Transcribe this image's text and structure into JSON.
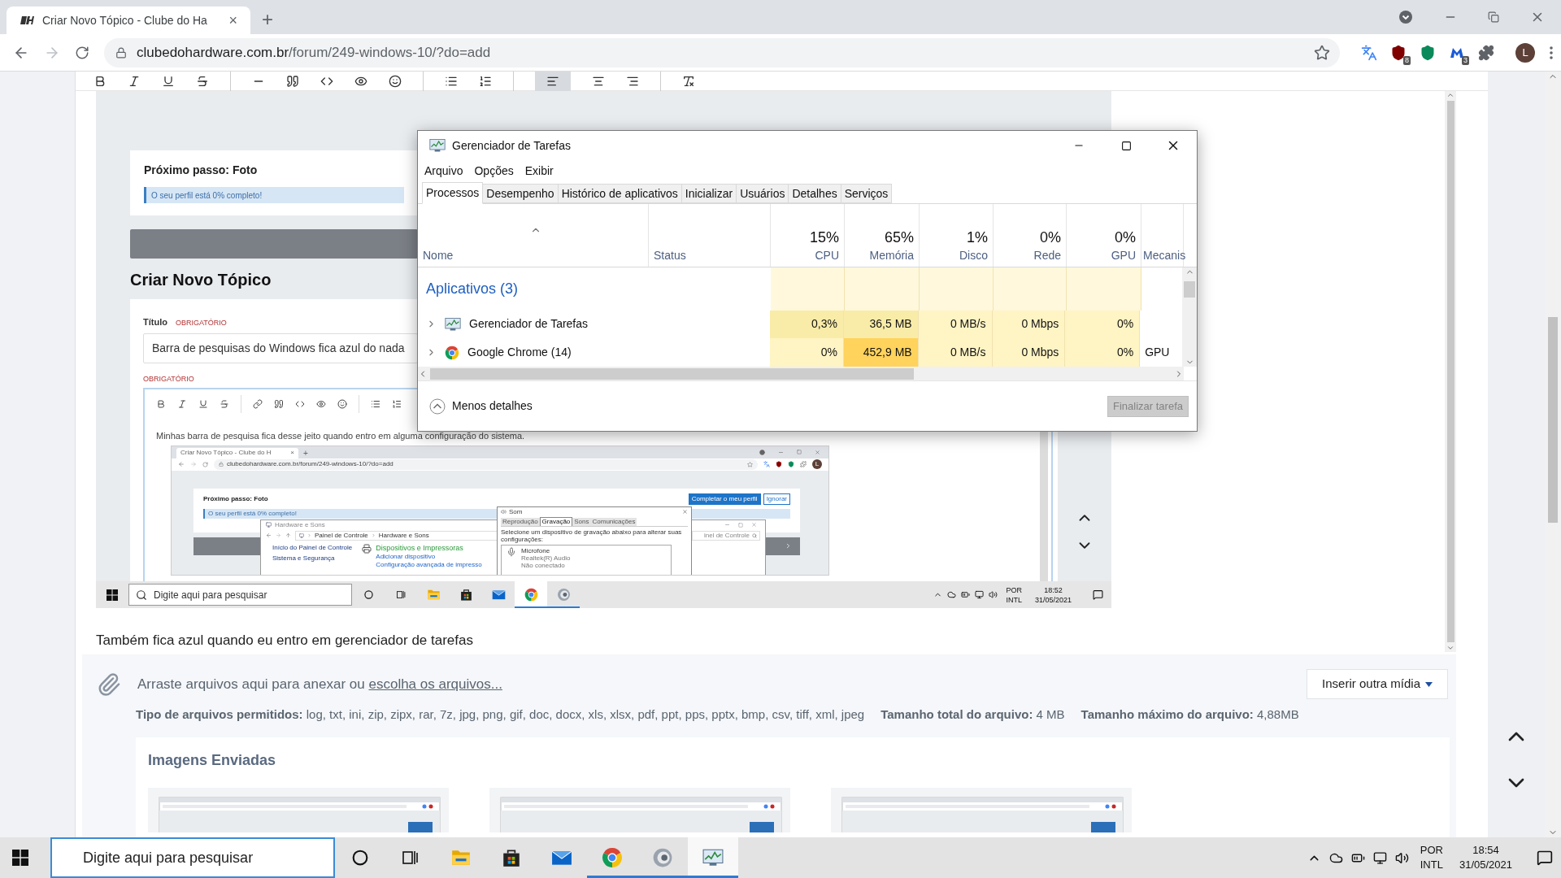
{
  "browser": {
    "tab_title": "Criar Novo Tópico - Clube do Ha",
    "tab_close": "×",
    "new_tab": "+",
    "url_host": "clubedohardware.com.br",
    "url_path": "/forum/249-windows-10/?do=add",
    "extensions": [
      {
        "kind": "translate"
      },
      {
        "kind": "ublock",
        "badge": "8"
      },
      {
        "kind": "shield"
      },
      {
        "kind": "mail",
        "badge": "3"
      },
      {
        "kind": "puzzle"
      }
    ],
    "profile_initial": "L"
  },
  "post_image": {
    "next_step_title": "Próximo passo: Foto",
    "progress_text": "O seu perfil está 0% completo!",
    "progress": {
      "level": 0
    },
    "heading": "Criar Novo Tópico",
    "title_label": "Título",
    "title_required": "OBRIGATÓRIO",
    "title_value": "Barra de pesquisas do Windows fica azul do nada",
    "content_required": "OBRIGATÓRIO",
    "content_text": "Minhas barra de pesquisa fica desse jeito quando entro em alguma configuração do sistema.",
    "inner_screenshot": {
      "tab_title": "Criar Novo Tópico - Clube do H",
      "tab_close": "×",
      "new_tab": "+",
      "url": "clubedohardware.com.br/forum/249-windows-10/?do=add",
      "profile_initial": "L",
      "next_step_title": "Próximo passo: Foto",
      "progress_text": "O seu perfil está 0% completo!",
      "complete_button": "Completar o meu perfil",
      "ignore_button": "Ignorar",
      "hardware_window": {
        "title": "Hardware e Sons",
        "breadcrumb": [
          "Painel de Controle",
          "Hardware e Sons"
        ],
        "search_placeholder": "inel de Controle",
        "sidebar": [
          "Início do Painel de Controle",
          "Sistema e Segurança"
        ],
        "category": "Dispositivos e Impressoras",
        "links": [
          "Adicionar dispositivo",
          "Configuração avançada de impresso"
        ]
      },
      "sound_dialog": {
        "title": "Som",
        "tabs": [
          {
            "label": "Reprodução",
            "selected": false
          },
          {
            "label": "Gravação",
            "selected": true
          },
          {
            "label": "Sons",
            "selected": false
          },
          {
            "label": "Comunicações",
            "selected": false
          }
        ],
        "instruction": "Selecione um dispositivo de gravação abaixo para alterar suas configurações:",
        "device_name": "Microfone",
        "device_driver": "Realtek(R) Audio",
        "device_status": "Não conectado"
      }
    },
    "taskbar": {
      "search_placeholder": "Digite aqui para pesquisar",
      "apps": [
        {
          "kind": "explorer",
          "running": false,
          "selected": false
        },
        {
          "kind": "store",
          "running": false,
          "selected": false
        },
        {
          "kind": "mail",
          "running": false,
          "selected": false
        },
        {
          "kind": "chrome",
          "running": true,
          "selected": true
        },
        {
          "kind": "speaker",
          "running": true,
          "selected": false
        }
      ],
      "language": "POR",
      "layout": "INTL",
      "time": "18:52",
      "date": "31/05/2021"
    }
  },
  "editor_text": "Também fica azul quando eu entro em gerenciador de tarefas",
  "attachments": {
    "drop_text": "Arraste arquivos aqui para anexar ou",
    "choose_link": "escolha os arquivos...",
    "media_button": "Inserir outra mídia",
    "allowed": "**Tipo de arquivos permitidos:** log, txt, ini, zip, zipx, rar, 7z, jpg, png, gif, doc, docx, xls, xlsx, pdf, ppt, pps, pptx, bmp, csv, tiff, xml, jpeg",
    "total": "**Tamanho total do arquivo:** 4 MB",
    "max": "**Tamanho máximo do arquivo:** 4,88MB",
    "uploaded_title": "Imagens Enviadas"
  },
  "task_manager": {
    "title": "Gerenciador de Tarefas",
    "menu": [
      "Arquivo",
      "Opções",
      "Exibir"
    ],
    "tabs": [
      {
        "label": "Processos",
        "selected": true
      },
      {
        "label": "Desempenho",
        "selected": false
      },
      {
        "label": "Histórico de aplicativos",
        "selected": false
      },
      {
        "label": "Inicializar",
        "selected": false
      },
      {
        "label": "Usuários",
        "selected": false
      },
      {
        "label": "Detalhes",
        "selected": false
      },
      {
        "label": "Serviços",
        "selected": false
      }
    ],
    "columns": [
      {
        "label": "Nome"
      },
      {
        "label": "Status"
      },
      {
        "label": "CPU",
        "total": "15%"
      },
      {
        "label": "Memória",
        "total": "65%"
      },
      {
        "label": "Disco",
        "total": "1%"
      },
      {
        "label": "Rede",
        "total": "0%"
      },
      {
        "label": "GPU",
        "total": "0%"
      },
      {
        "label": "Mecanis"
      }
    ],
    "group": "Aplicativos (3)",
    "rows": [
      {
        "expanded": false,
        "cells": [
          {
            "text": "Gerenciador de Tarefas"
          },
          {
            "text": ""
          },
          {
            "text": "0,3%",
            "color": "#f9eca8"
          },
          {
            "text": "36,5 MB",
            "color": "#f9eca8"
          },
          {
            "text": "0 MB/s",
            "color": "#fff4c4"
          },
          {
            "text": "0 Mbps",
            "color": "#fff4c4"
          },
          {
            "text": "0%",
            "color": "#fff4c4"
          },
          {
            "text": ""
          }
        ]
      },
      {
        "expanded": false,
        "cells": [
          {
            "text": "Google Chrome (14)"
          },
          {
            "text": ""
          },
          {
            "text": "0%",
            "color": "#fff4c4"
          },
          {
            "text": "452,9 MB",
            "color": "#ffd35c"
          },
          {
            "text": "0 MB/s",
            "color": "#fff4c4"
          },
          {
            "text": "0 Mbps",
            "color": "#fff4c4"
          },
          {
            "text": "0%",
            "color": "#fff4c4"
          },
          {
            "text": "GPU"
          }
        ]
      }
    ],
    "less_details": "Menos detalhes",
    "end_task": {
      "label": "Finalizar tarefa",
      "disabled": true
    }
  },
  "taskbar": {
    "search_placeholder": "Digite aqui para pesquisar",
    "apps": [
      {
        "kind": "explorer",
        "running": false,
        "selected": false
      },
      {
        "kind": "store",
        "running": false,
        "selected": false
      },
      {
        "kind": "mail",
        "running": false,
        "selected": false
      },
      {
        "kind": "chrome",
        "running": true,
        "selected": false
      },
      {
        "kind": "speaker",
        "running": true,
        "selected": false
      },
      {
        "kind": "taskmgr",
        "running": true,
        "selected": true
      }
    ],
    "language": "POR",
    "layout": "INTL",
    "time": "18:54",
    "date": "31/05/2021"
  }
}
